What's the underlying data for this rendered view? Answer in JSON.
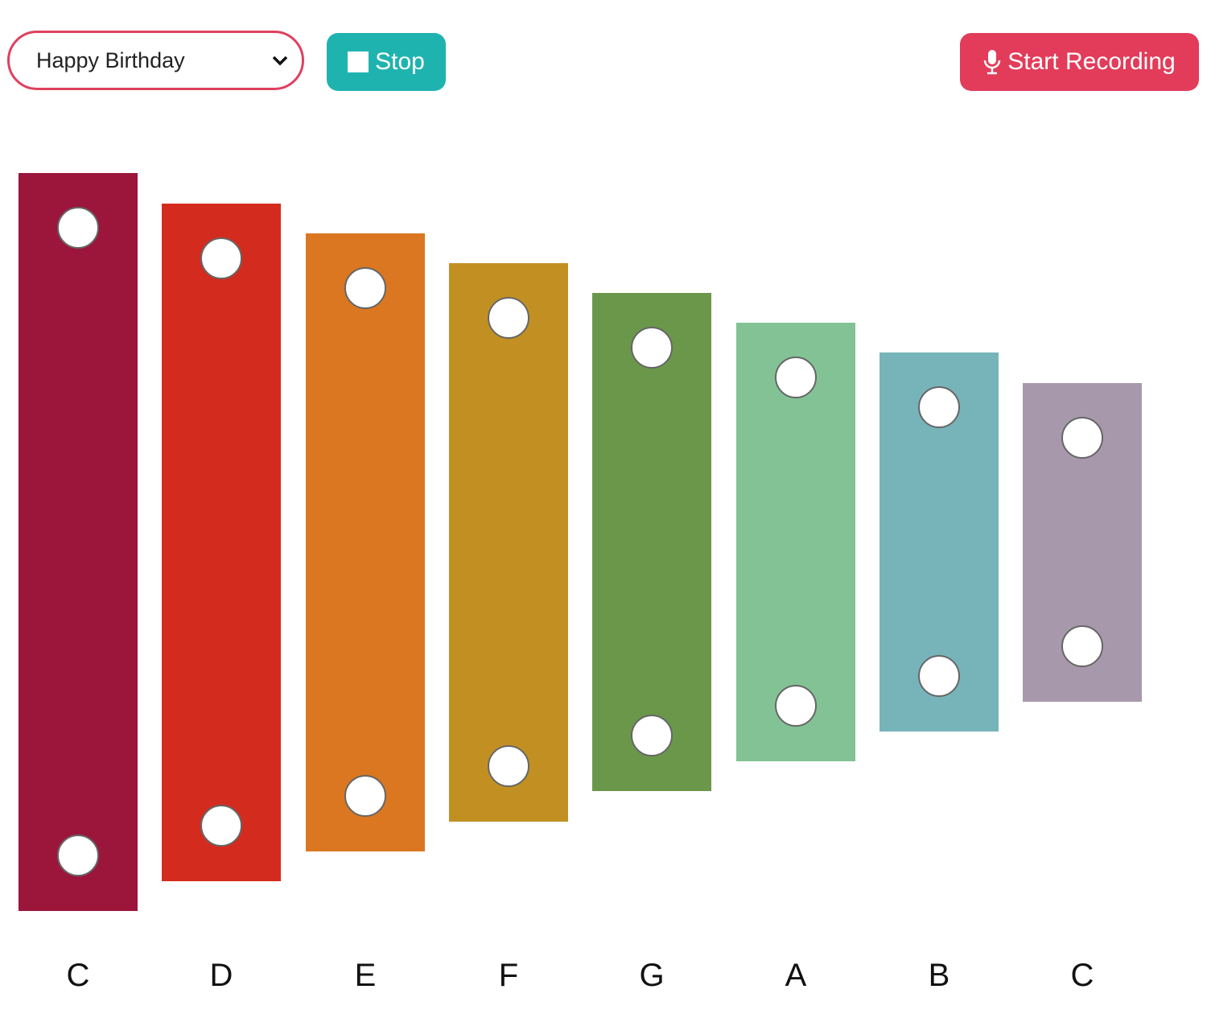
{
  "toolbar": {
    "song_select": {
      "selected": "Happy Birthday",
      "icon": "chevron-down-icon"
    },
    "stop_button": {
      "label": "Stop",
      "icon": "stop-square-icon",
      "color": "#1fb3b0"
    },
    "record_button": {
      "label": "Start Recording",
      "icon": "microphone-icon",
      "color": "#e23c5a"
    }
  },
  "xylophone": {
    "bars": [
      {
        "note": "C",
        "color": "#9c163c"
      },
      {
        "note": "D",
        "color": "#d42b1f"
      },
      {
        "note": "E",
        "color": "#db7720"
      },
      {
        "note": "F",
        "color": "#c29022"
      },
      {
        "note": "G",
        "color": "#6a974a"
      },
      {
        "note": "A",
        "color": "#83c295"
      },
      {
        "note": "B",
        "color": "#77b4ba"
      },
      {
        "note": "C",
        "color": "#a799ab"
      }
    ]
  }
}
